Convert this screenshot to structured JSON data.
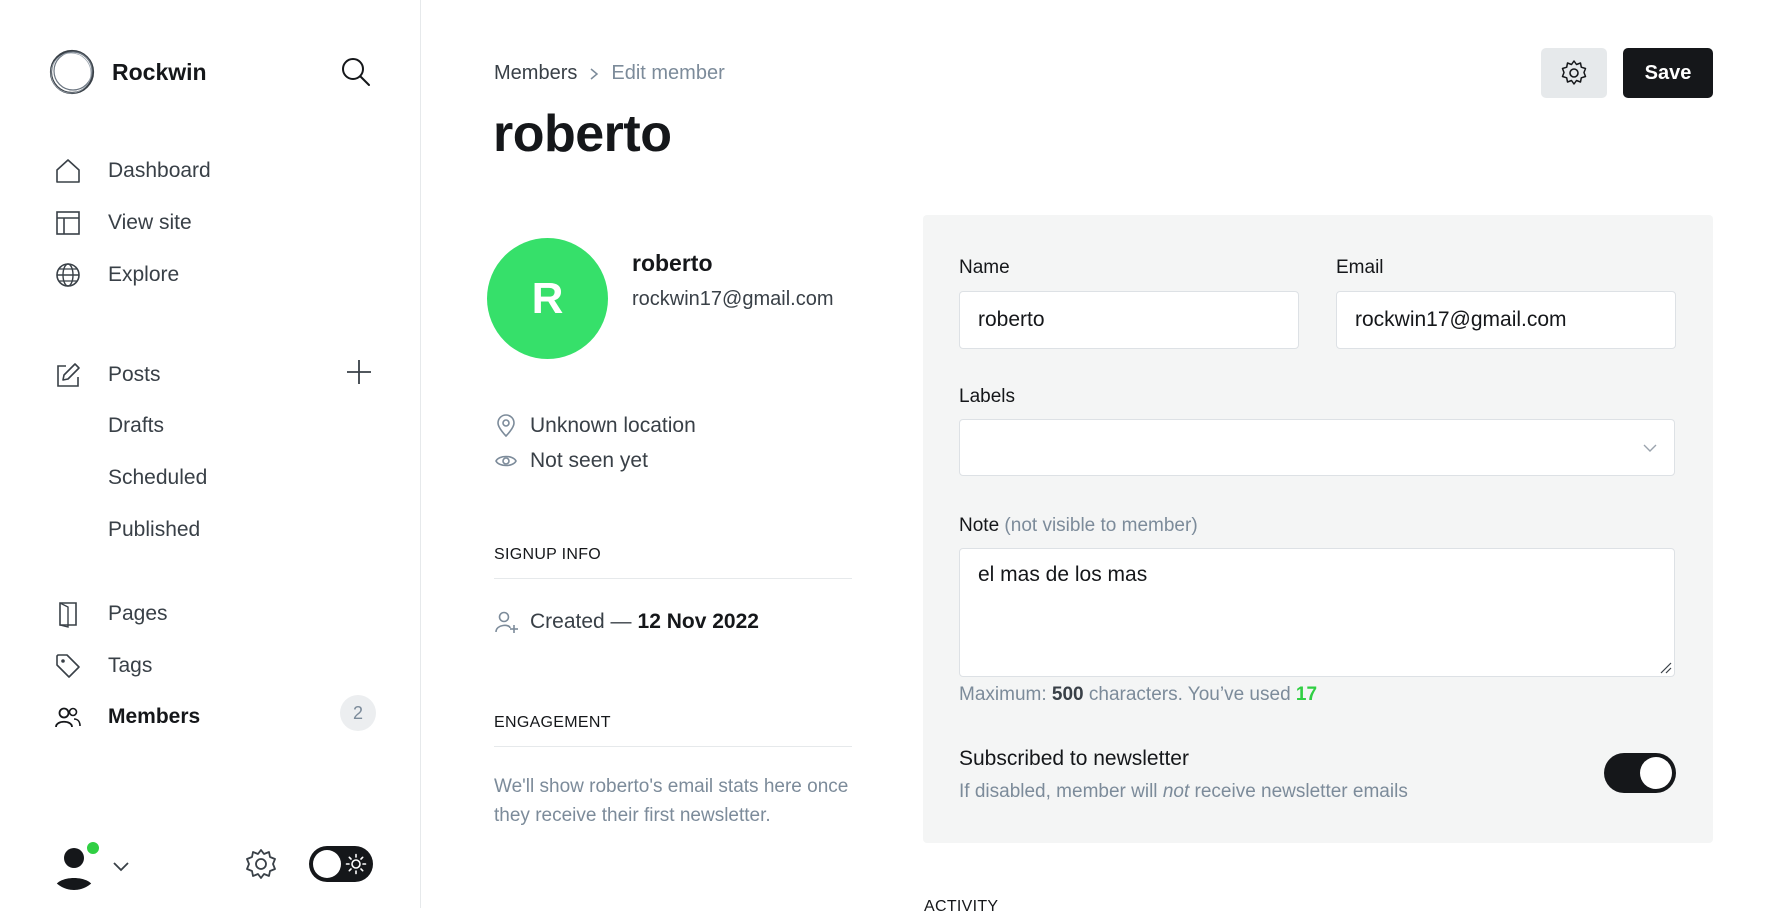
{
  "sidebar": {
    "brand": "Rockwin",
    "nav_primary": [
      {
        "label": "Dashboard",
        "icon": "home-icon"
      },
      {
        "label": "View site",
        "icon": "layout-icon"
      },
      {
        "label": "Explore",
        "icon": "globe-icon"
      }
    ],
    "posts": {
      "label": "Posts",
      "icon": "edit-icon"
    },
    "posts_sub": [
      {
        "label": "Drafts"
      },
      {
        "label": "Scheduled"
      },
      {
        "label": "Published"
      }
    ],
    "nav_secondary": [
      {
        "label": "Pages",
        "icon": "page-icon"
      },
      {
        "label": "Tags",
        "icon": "tag-icon"
      },
      {
        "label": "Members",
        "icon": "members-icon",
        "count": "2",
        "active": true
      }
    ]
  },
  "header": {
    "breadcrumb_parent": "Members",
    "breadcrumb_current": "Edit member",
    "title": "roberto",
    "save_label": "Save"
  },
  "member": {
    "initial": "R",
    "name": "roberto",
    "email": "rockwin17@gmail.com",
    "location": "Unknown location",
    "last_seen": "Not seen yet",
    "avatar_color": "#36e06a"
  },
  "signup": {
    "heading": "SIGNUP INFO",
    "created_label": "Created —",
    "created_date": "12 Nov 2022"
  },
  "engagement": {
    "heading": "ENGAGEMENT",
    "text": "We'll show roberto's email stats here once they receive their first newsletter."
  },
  "form": {
    "name_label": "Name",
    "name_value": "roberto",
    "email_label": "Email",
    "email_value": "rockwin17@gmail.com",
    "labels_label": "Labels",
    "labels_value": "",
    "note_label": "Note",
    "note_hint": "(not visible to member)",
    "note_value": "el mas de los mas",
    "char_prefix": "Maximum:",
    "char_max": "500",
    "char_middle": "characters. You’ve used",
    "char_used": "17",
    "newsletter_title": "Subscribed to newsletter",
    "newsletter_desc_before": "If disabled, member will",
    "newsletter_desc_em": "not",
    "newsletter_desc_after": "receive newsletter emails",
    "newsletter_enabled": true
  },
  "activity": {
    "heading": "ACTIVITY"
  },
  "colors": {
    "accent_green": "#30cf43",
    "dark": "#15171a",
    "muted": "#7c8b9a"
  }
}
